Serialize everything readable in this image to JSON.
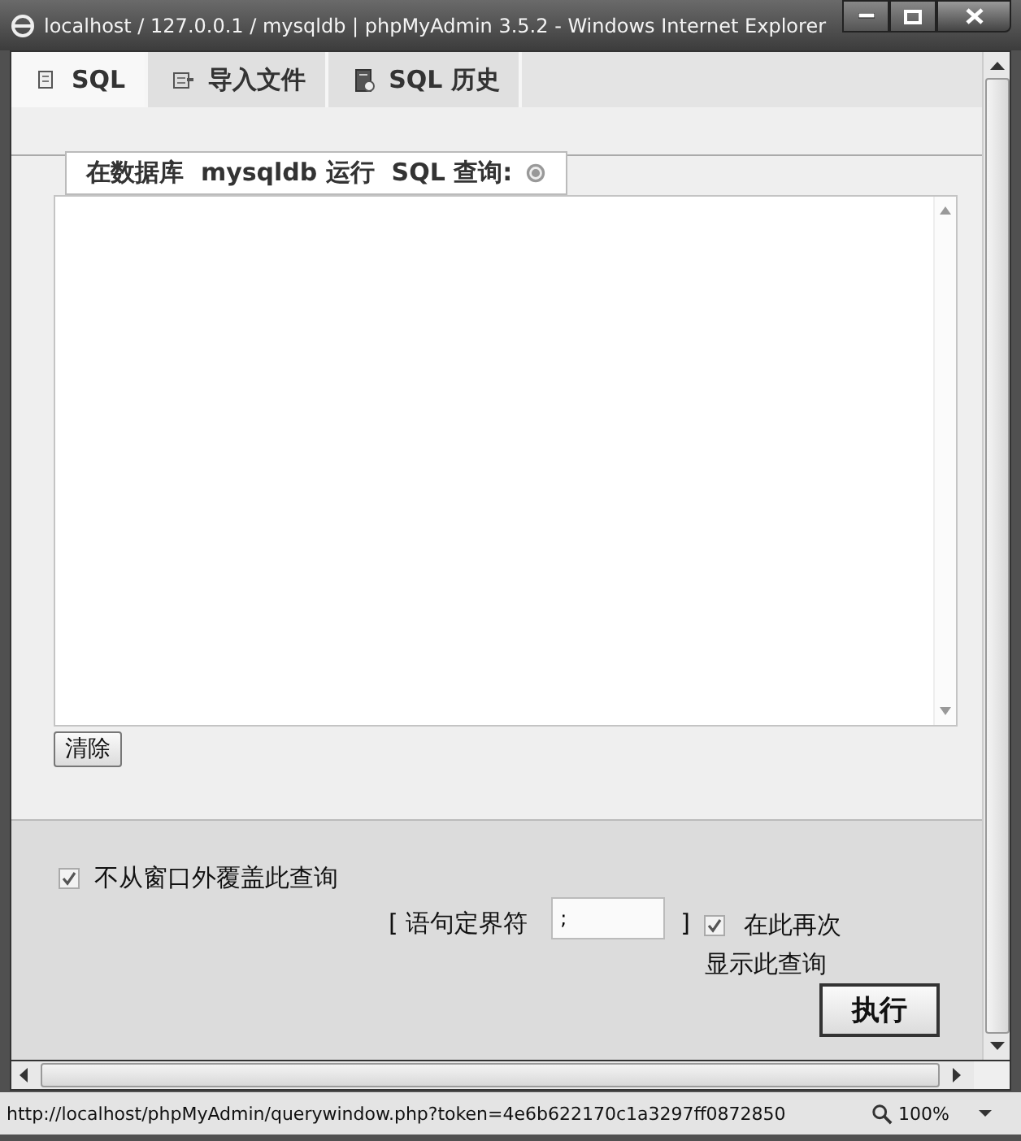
{
  "window": {
    "title": "localhost / 127.0.0.1 / mysqldb | phpMyAdmin 3.5.2 - Windows Internet Explorer"
  },
  "tabs": [
    {
      "label": "SQL",
      "kind": "scroll",
      "selected": true
    },
    {
      "label": "导入文件",
      "kind": "import",
      "selected": false
    },
    {
      "label": "SQL 历史",
      "kind": "history",
      "selected": false
    }
  ],
  "query_box": {
    "legend": "在数据库  mysqldb 运行  SQL 查询:",
    "clear_button": "清除"
  },
  "options": {
    "overwrite": {
      "label": "不从窗口外覆盖此查询",
      "checked": true
    },
    "delimiter_open": "[ 语句定界符",
    "delimiter": {
      "value": ";"
    },
    "delimiter_close": "]",
    "show_again": {
      "label_lines": [
        "在此再次",
        "显示此查询"
      ],
      "checked": true
    },
    "submit_button": "执行"
  },
  "status_bar": {
    "url": "http://localhost/phpMyAdmin/querywindow.php?token=4e6b622170c1a3297ff0872850",
    "zoom": "100%"
  }
}
